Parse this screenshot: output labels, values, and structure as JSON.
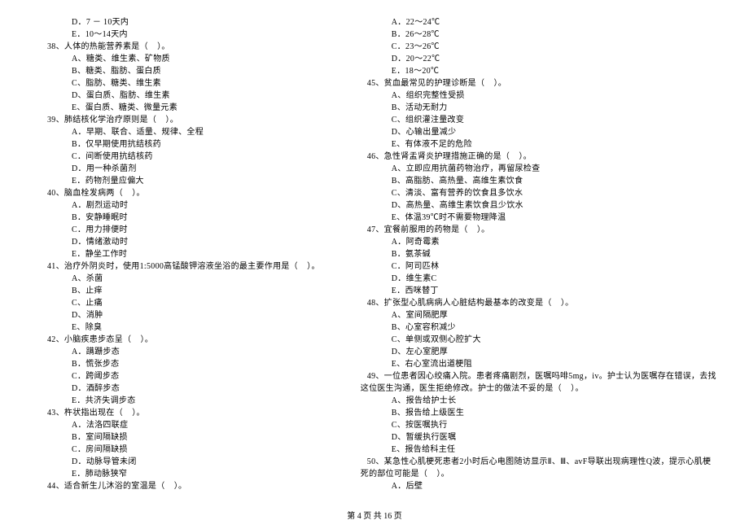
{
  "left_col": [
    {
      "cls": "option",
      "text": "D．7 － 10天内"
    },
    {
      "cls": "option",
      "text": "E．10～14天内"
    },
    {
      "cls": "question",
      "text": "38、人体的热能营养素是（    ）。"
    },
    {
      "cls": "option",
      "text": "A、糖类、维生素、矿物质"
    },
    {
      "cls": "option",
      "text": "B、糖类、脂肪、蛋白质"
    },
    {
      "cls": "option",
      "text": "C、脂肪、糖类、维生素"
    },
    {
      "cls": "option",
      "text": "D、蛋白质、脂肪、维生素"
    },
    {
      "cls": "option",
      "text": "E、蛋白质、糖类、微量元素"
    },
    {
      "cls": "question",
      "text": "39、肺结核化学治疗原则是（    ）。"
    },
    {
      "cls": "option",
      "text": "A．早期、联合、适量、规律、全程"
    },
    {
      "cls": "option",
      "text": "B．仅早期使用抗结核药"
    },
    {
      "cls": "option",
      "text": "C．间断使用抗结核药"
    },
    {
      "cls": "option",
      "text": "D．用一种杀菌剂"
    },
    {
      "cls": "option",
      "text": "E．药物剂量应偏大"
    },
    {
      "cls": "question",
      "text": "40、脑血栓发病两（    ）。"
    },
    {
      "cls": "option",
      "text": "A．剧烈运动时"
    },
    {
      "cls": "option",
      "text": "B．安静睡眠时"
    },
    {
      "cls": "option",
      "text": "C．用力排便时"
    },
    {
      "cls": "option",
      "text": "D．情绪激动时"
    },
    {
      "cls": "option",
      "text": "E．静坐工作时"
    },
    {
      "cls": "question",
      "text": "41、治疗外阴炎时，使用1:5000高锰酸钾溶液坐浴的最主要作用是（    ）。"
    },
    {
      "cls": "option",
      "text": "A、杀菌"
    },
    {
      "cls": "option",
      "text": "B、止痒"
    },
    {
      "cls": "option",
      "text": "C、止痛"
    },
    {
      "cls": "option",
      "text": "D、消肿"
    },
    {
      "cls": "option",
      "text": "E、除臭"
    },
    {
      "cls": "question",
      "text": "42、小脑疾患步态呈（    ）。"
    },
    {
      "cls": "option",
      "text": "A．蹒跚步态"
    },
    {
      "cls": "option",
      "text": "B．慌张步态"
    },
    {
      "cls": "option",
      "text": "C．跨阈步态"
    },
    {
      "cls": "option",
      "text": "D．酒醉步态"
    },
    {
      "cls": "option",
      "text": "E．共济失调步态"
    },
    {
      "cls": "question",
      "text": "43、杵状指出现在（    ）。"
    },
    {
      "cls": "option",
      "text": "A．法洛四联症"
    },
    {
      "cls": "option",
      "text": "B．室间隔缺损"
    },
    {
      "cls": "option",
      "text": "C．房间隔缺损"
    },
    {
      "cls": "option",
      "text": "D．动脉导管未闭"
    },
    {
      "cls": "option",
      "text": "E．肺动脉狭窄"
    },
    {
      "cls": "question",
      "text": "44、适合新生儿沐浴的室温是（    ）。"
    }
  ],
  "right_col": [
    {
      "cls": "option",
      "text": "A．22～24℃"
    },
    {
      "cls": "option",
      "text": "B．26～28℃"
    },
    {
      "cls": "option",
      "text": "C．23～26℃"
    },
    {
      "cls": "option",
      "text": "D．20～22℃"
    },
    {
      "cls": "option",
      "text": "E．18～20℃"
    },
    {
      "cls": "question",
      "text": "45、贫血最常见的护理诊断是（    ）。"
    },
    {
      "cls": "option",
      "text": "A、组织完整性受损"
    },
    {
      "cls": "option",
      "text": "B、活动无耐力"
    },
    {
      "cls": "option",
      "text": "C、组织灌注量改变"
    },
    {
      "cls": "option",
      "text": "D、心输出量减少"
    },
    {
      "cls": "option",
      "text": "E、有体液不足的危险"
    },
    {
      "cls": "question",
      "text": "46、急性肾盂肾炎护理措施正确的是（    ）。"
    },
    {
      "cls": "option",
      "text": "A、立即应用抗菌药物治疗，再留尿检查"
    },
    {
      "cls": "option",
      "text": "B、高脂肪、高热量、高维生素饮食"
    },
    {
      "cls": "option",
      "text": "C、清淡、富有营养的饮食且多饮水"
    },
    {
      "cls": "option",
      "text": "D、高热量、高维生素饮食且少饮水"
    },
    {
      "cls": "option",
      "text": "E、体温39℃时不需要物理降温"
    },
    {
      "cls": "question",
      "text": "47、宜餐前服用的药物是（    ）。"
    },
    {
      "cls": "option",
      "text": "A．阿奇霉素"
    },
    {
      "cls": "option",
      "text": "B．氨茶碱"
    },
    {
      "cls": "option",
      "text": "C．阿司匹林"
    },
    {
      "cls": "option",
      "text": "D．维生素C"
    },
    {
      "cls": "option",
      "text": "E．西咪替丁"
    },
    {
      "cls": "question",
      "text": "48、扩张型心肌病病人心脏结构最基本的改变是（    ）。"
    },
    {
      "cls": "option",
      "text": "A、室间隔肥厚"
    },
    {
      "cls": "option",
      "text": "B、心室容积减少"
    },
    {
      "cls": "option",
      "text": "C、单侧或双侧心腔扩大"
    },
    {
      "cls": "option",
      "text": "D、左心室肥厚"
    },
    {
      "cls": "option",
      "text": "E、右心室流出道梗阻"
    },
    {
      "cls": "question",
      "text": "49、一位患者因心绞痛入院。患者疼痛剧烈，医嘱吗啡5mg，iv。护士认为医嘱存在错误，去找"
    },
    {
      "cls": "continuation",
      "text": "这位医生沟通，医生拒绝修改。护士的做法不妥的是（    ）。"
    },
    {
      "cls": "option",
      "text": "A、报告给护士长"
    },
    {
      "cls": "option",
      "text": "B、报告给上级医生"
    },
    {
      "cls": "option",
      "text": "C、按医嘱执行"
    },
    {
      "cls": "option",
      "text": "D、暂缓执行医嘱"
    },
    {
      "cls": "option",
      "text": "E、报告给科主任"
    },
    {
      "cls": "question",
      "text": "50、某急性心肌梗死患者2小时后心电图随访显示Ⅱ、Ⅲ、avF导联出现病理性Q波，提示心肌梗"
    },
    {
      "cls": "continuation",
      "text": "死的部位可能是（    ）。"
    },
    {
      "cls": "option",
      "text": "A．后壁"
    }
  ],
  "footer": "第 4 页 共 16 页"
}
